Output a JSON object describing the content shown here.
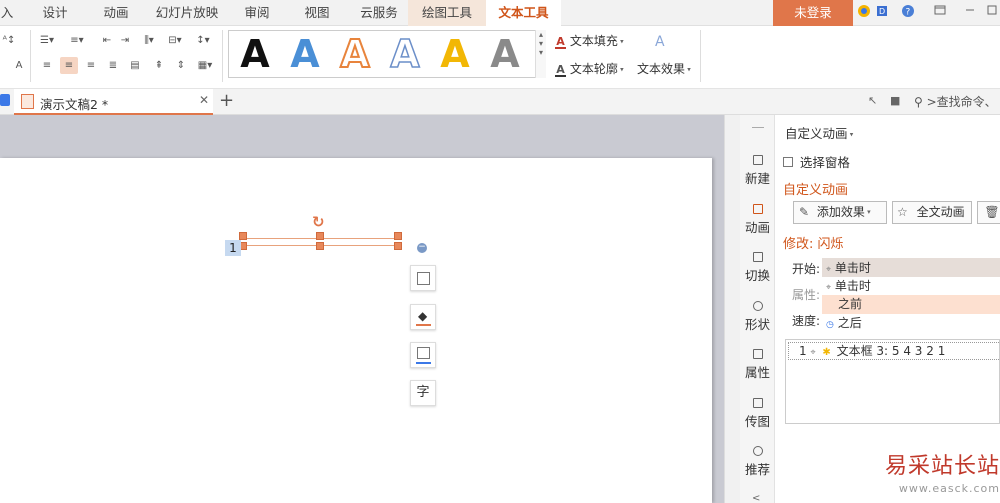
{
  "menu": {
    "cut_left": "入",
    "tabs": [
      "设计",
      "动画",
      "幻灯片放映",
      "审阅",
      "视图",
      "云服务"
    ],
    "context_tabs": [
      "绘图工具",
      "文本工具"
    ],
    "login": "未登录"
  },
  "ribbon": {
    "text_fill": "文本填充",
    "text_outline": "文本轮廓",
    "text_effect": "文本效果",
    "wordart_letter": "A",
    "wordart_colors": [
      "#111111",
      "#4a8fd6",
      "#e8843c",
      "#6c8fc9",
      "#f2b705",
      "#8a8a8a"
    ]
  },
  "doctab": {
    "title": "演示文稿2 *",
    "search": ">查找命令、"
  },
  "slide": {
    "textbox_number": "1",
    "quick_edit": "字"
  },
  "sidebar": {
    "items": [
      "新建",
      "动画",
      "切换",
      "形状",
      "属性",
      "传图",
      "推荐"
    ]
  },
  "pane": {
    "header": "自定义动画",
    "select_window": "选择窗格",
    "section_title": "自定义动画",
    "add_effect": "添加效果",
    "full_text_anim": "全文动画",
    "modify_title": "修改: 闪烁",
    "start_label": "开始:",
    "property_label": "属性:",
    "speed_label": "速度:",
    "start_value": "单击时",
    "options": [
      "单击时",
      "之前",
      "之后"
    ],
    "list_item": "1",
    "list_item_text": "文本框 3: 5 4 3 2 1"
  },
  "watermark": {
    "title": "易采站长站",
    "url": "www.easck.com"
  },
  "colors": {
    "accent": "#e0764a",
    "accent_text": "#d0551a",
    "context_tab_bg": "#f5e6da",
    "workspace_gray": "#c9cad2"
  }
}
